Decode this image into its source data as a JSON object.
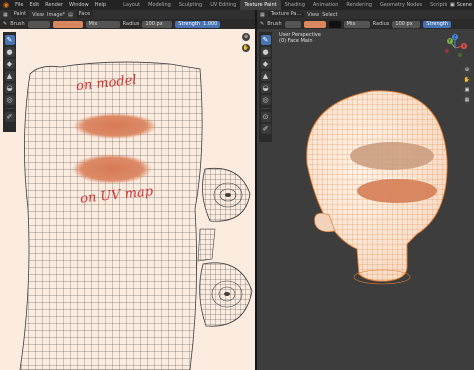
{
  "topbar": {
    "menus": [
      "File",
      "Edit",
      "Render",
      "Window",
      "Help"
    ],
    "workspaces": [
      "Layout",
      "Modeling",
      "Sculpting",
      "UV Editing",
      "Texture Paint",
      "Shading",
      "Animation",
      "Rendering",
      "Geometry Nodes",
      "Scripting"
    ],
    "active_workspace": "Texture Paint",
    "scene_label": "Scene"
  },
  "uv_editor": {
    "header": {
      "mode": "Paint",
      "menus": [
        "View",
        "Image*"
      ],
      "image_name": "Face"
    },
    "tool_settings": {
      "brush_label": "Brush",
      "blend": "Mix",
      "radius_label": "Radius",
      "radius_value": "100 px",
      "strength_label": "Strength",
      "strength_value": "1.000"
    },
    "annotations": {
      "top": "on model",
      "bottom": "on UV map"
    }
  },
  "viewport": {
    "header": {
      "mode": "Texture Pa...",
      "menus": [
        "View",
        "Select"
      ]
    },
    "tool_settings": {
      "brush_label": "Brush",
      "blend": "Mix",
      "radius_label": "Radius",
      "radius_value": "100 px",
      "strength_label": "Strength"
    },
    "overlay": {
      "perspective": "User Perspective",
      "object": "(0) Face Main"
    },
    "gizmo": {
      "x": "X",
      "y": "Y",
      "z": "Z"
    }
  },
  "colors": {
    "accent": "#4772b3",
    "paint": "#d9875f",
    "uv_bg": "#fcebdf",
    "viewport_bg": "#3d3d3d",
    "mesh_wire": "#e07b2f"
  }
}
